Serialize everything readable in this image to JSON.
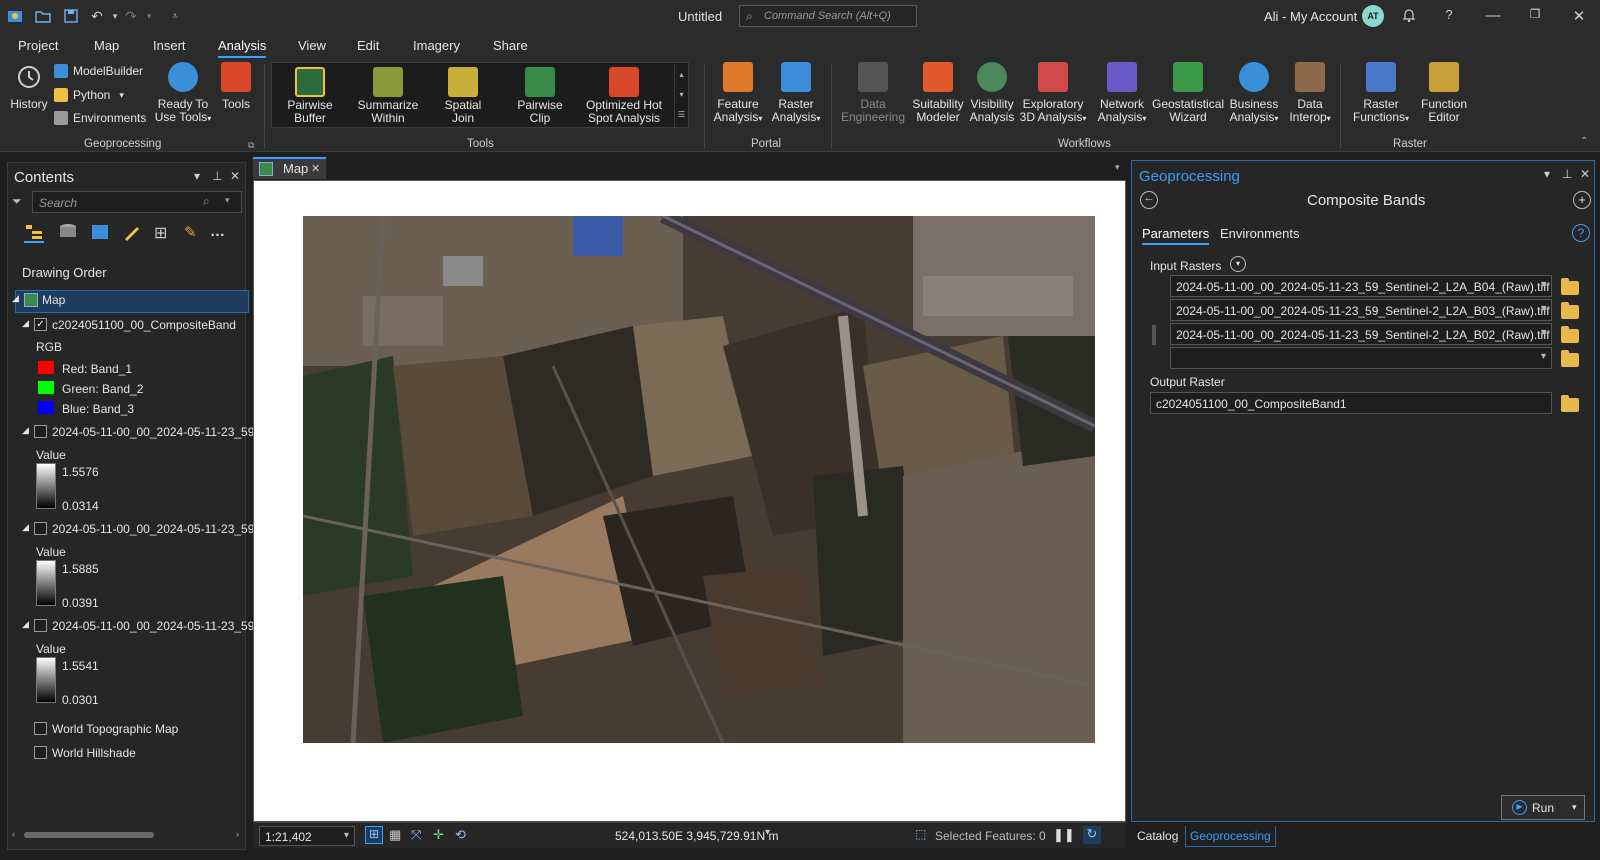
{
  "window": {
    "title": "Untitled",
    "command_search_placeholder": "Command Search (Alt+Q)",
    "account": "Ali - My Account",
    "avatar_initials": "AT"
  },
  "menu_tabs": [
    "Project",
    "Map",
    "Insert",
    "Analysis",
    "View",
    "Edit",
    "Imagery",
    "Share"
  ],
  "ribbon": {
    "geoprocessing": {
      "history": "History",
      "modelbuilder": "ModelBuilder",
      "python": "Python",
      "environments": "Environments",
      "ready_to_use_1": "Ready To",
      "ready_to_use_2": "Use Tools",
      "tools": "Tools",
      "group_label": "Geoprocessing"
    },
    "tools": {
      "pairwise_buffer_1": "Pairwise",
      "pairwise_buffer_2": "Buffer",
      "summarize_within_1": "Summarize",
      "summarize_within_2": "Within",
      "spatial_join_1": "Spatial",
      "spatial_join_2": "Join",
      "pairwise_clip_1": "Pairwise",
      "pairwise_clip_2": "Clip",
      "hot_spot_1": "Optimized Hot",
      "hot_spot_2": "Spot Analysis",
      "group_label": "Tools"
    },
    "portal": {
      "feature_analysis_1": "Feature",
      "feature_analysis_2": "Analysis",
      "raster_analysis_1": "Raster",
      "raster_analysis_2": "Analysis",
      "group_label": "Portal"
    },
    "workflows": {
      "data_engineering_1": "Data",
      "data_engineering_2": "Engineering",
      "suitability_1": "Suitability",
      "suitability_2": "Modeler",
      "visibility_1": "Visibility",
      "visibility_2": "Analysis",
      "exploratory_1": "Exploratory",
      "exploratory_2": "3D Analysis",
      "network_1": "Network",
      "network_2": "Analysis",
      "geostat_1": "Geostatistical",
      "geostat_2": "Wizard",
      "business_1": "Business",
      "business_2": "Analysis",
      "interop_1": "Data",
      "interop_2": "Interop",
      "group_label": "Workflows"
    },
    "raster": {
      "raster_functions_1": "Raster",
      "raster_functions_2": "Functions",
      "function_editor_1": "Function",
      "function_editor_2": "Editor",
      "group_label": "Raster"
    }
  },
  "contents": {
    "title": "Contents",
    "search_placeholder": "Search",
    "drawing_order": "Drawing Order",
    "map_label": "Map",
    "composite_layer": "c2024051100_00_CompositeBand",
    "rgb_label": "RGB",
    "red": "Red:   Band_1",
    "green": "Green: Band_2",
    "blue": "Blue:  Band_3",
    "band_layers": [
      {
        "name": "2024-05-11-00_00_2024-05-11-23_59_",
        "value_label": "Value",
        "max": "1.5576",
        "min": "0.0314"
      },
      {
        "name": "2024-05-11-00_00_2024-05-11-23_59_",
        "value_label": "Value",
        "max": "1.5885",
        "min": "0.0391"
      },
      {
        "name": "2024-05-11-00_00_2024-05-11-23_59_",
        "value_label": "Value",
        "max": "1.5541",
        "min": "0.0301"
      }
    ],
    "basemap_topo": "World Topographic Map",
    "basemap_hillshade": "World Hillshade"
  },
  "map": {
    "tab_label": "Map",
    "scale": "1:21,402",
    "coordinates": "524,013.50E 3,945,729.91N m",
    "selected_features": "Selected Features: 0"
  },
  "geoprocessing": {
    "title": "Geoprocessing",
    "tool_name": "Composite Bands",
    "tab_parameters": "Parameters",
    "tab_environments": "Environments",
    "input_rasters_label": "Input Rasters",
    "input_rasters": [
      "2024-05-11-00_00_2024-05-11-23_59_Sentinel-2_L2A_B04_(Raw).tiff",
      "2024-05-11-00_00_2024-05-11-23_59_Sentinel-2_L2A_B03_(Raw).tiff",
      "2024-05-11-00_00_2024-05-11-23_59_Sentinel-2_L2A_B02_(Raw).tiff",
      ""
    ],
    "output_raster_label": "Output Raster",
    "output_raster": "c2024051100_00_CompositeBand1",
    "run_label": "Run"
  },
  "bottom_tabs": {
    "catalog": "Catalog",
    "geoprocessing": "Geoprocessing"
  },
  "colors": {
    "accent": "#3aa0ff",
    "red_swatch": "#ff0000",
    "green_swatch": "#00ff00",
    "blue_swatch": "#0000ff"
  }
}
